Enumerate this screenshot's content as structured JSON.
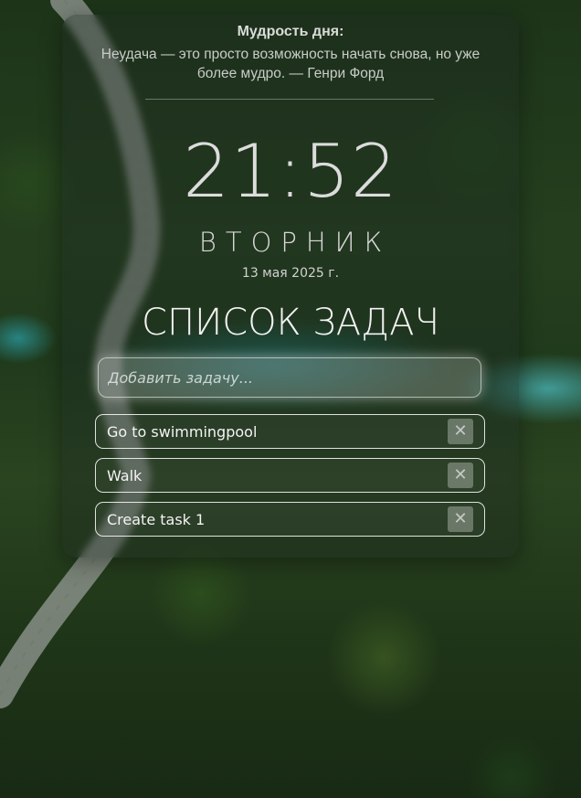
{
  "quote": {
    "title": "Мудрость дня:",
    "text": "Неудача — это просто возможность начать снова, но уже более мудро. — Генри Форд"
  },
  "clock": {
    "time": "21:52",
    "weekday": "ВТОРНИК",
    "date": "13 мая 2025 г."
  },
  "tasks": {
    "title": "СПИСОК ЗАДАЧ",
    "input_placeholder": "Добавить задачу...",
    "items": [
      {
        "text": "Go to swimmingpool",
        "delete_label": "✕"
      },
      {
        "text": "Walk",
        "delete_label": "✕"
      },
      {
        "text": "Create task 1",
        "delete_label": "✕"
      }
    ]
  }
}
